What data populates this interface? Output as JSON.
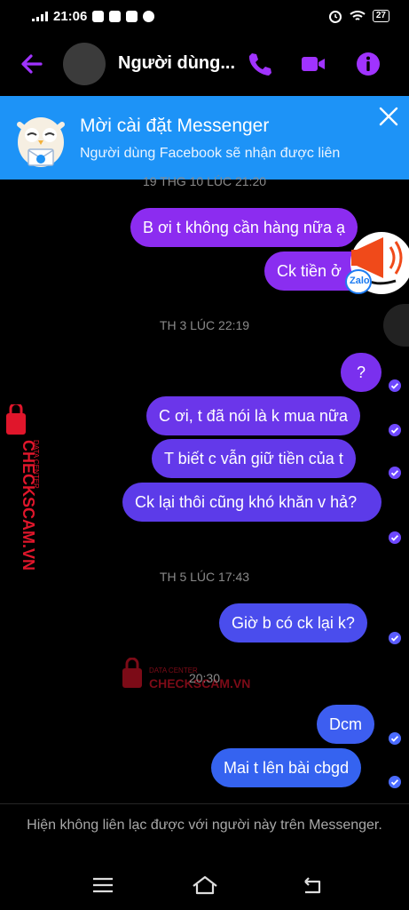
{
  "status_bar": {
    "time": "21:06",
    "battery": "27"
  },
  "header": {
    "contact_name": "Người dùng..."
  },
  "banner": {
    "title": "Mời cài đặt Messenger",
    "subtitle": "Người dùng Facebook sẽ nhận được liên"
  },
  "chat": {
    "partial_timestamp": "19 THG 10 LÚC 21:20",
    "timestamp_1": "TH 3 LÚC 22:19",
    "timestamp_2": "TH 5 LÚC 17:43",
    "timestamp_3": "20:30",
    "messages": [
      {
        "text": "B ơi t không cần hàng nữa ạ"
      },
      {
        "text": "Ck tiền ở"
      },
      {
        "text": "?"
      },
      {
        "text": "C ơi, t đã nói là k mua nữa"
      },
      {
        "text": "T biết c vẫn giữ tiền của t"
      },
      {
        "text": "Ck lại thôi cũng khó khăn v hả?"
      },
      {
        "text": "Giờ b có ck lại k?"
      },
      {
        "text": "Dcm"
      },
      {
        "text": "Mai t lên bài cbgd"
      }
    ]
  },
  "watermark": {
    "brand": "CHECKSCAM.VN",
    "tagline": "DATA CENTER"
  },
  "zalo_label": "Zalo",
  "footer": {
    "text": "Hiện không liên lạc được với người này trên Messenger."
  },
  "colors": {
    "accent": "#a033ff",
    "banner": "#1d93f7",
    "bubble_purple": "#8c2cf0",
    "bubble_violet": "#6a38e8",
    "bubble_blue": "#3e5ff0",
    "watermark": "#e0162b"
  },
  "icons": [
    "back-arrow-icon",
    "phone-icon",
    "video-call-icon",
    "info-icon",
    "close-icon",
    "read-receipt-icon",
    "menu-icon",
    "home-icon",
    "back-icon"
  ]
}
